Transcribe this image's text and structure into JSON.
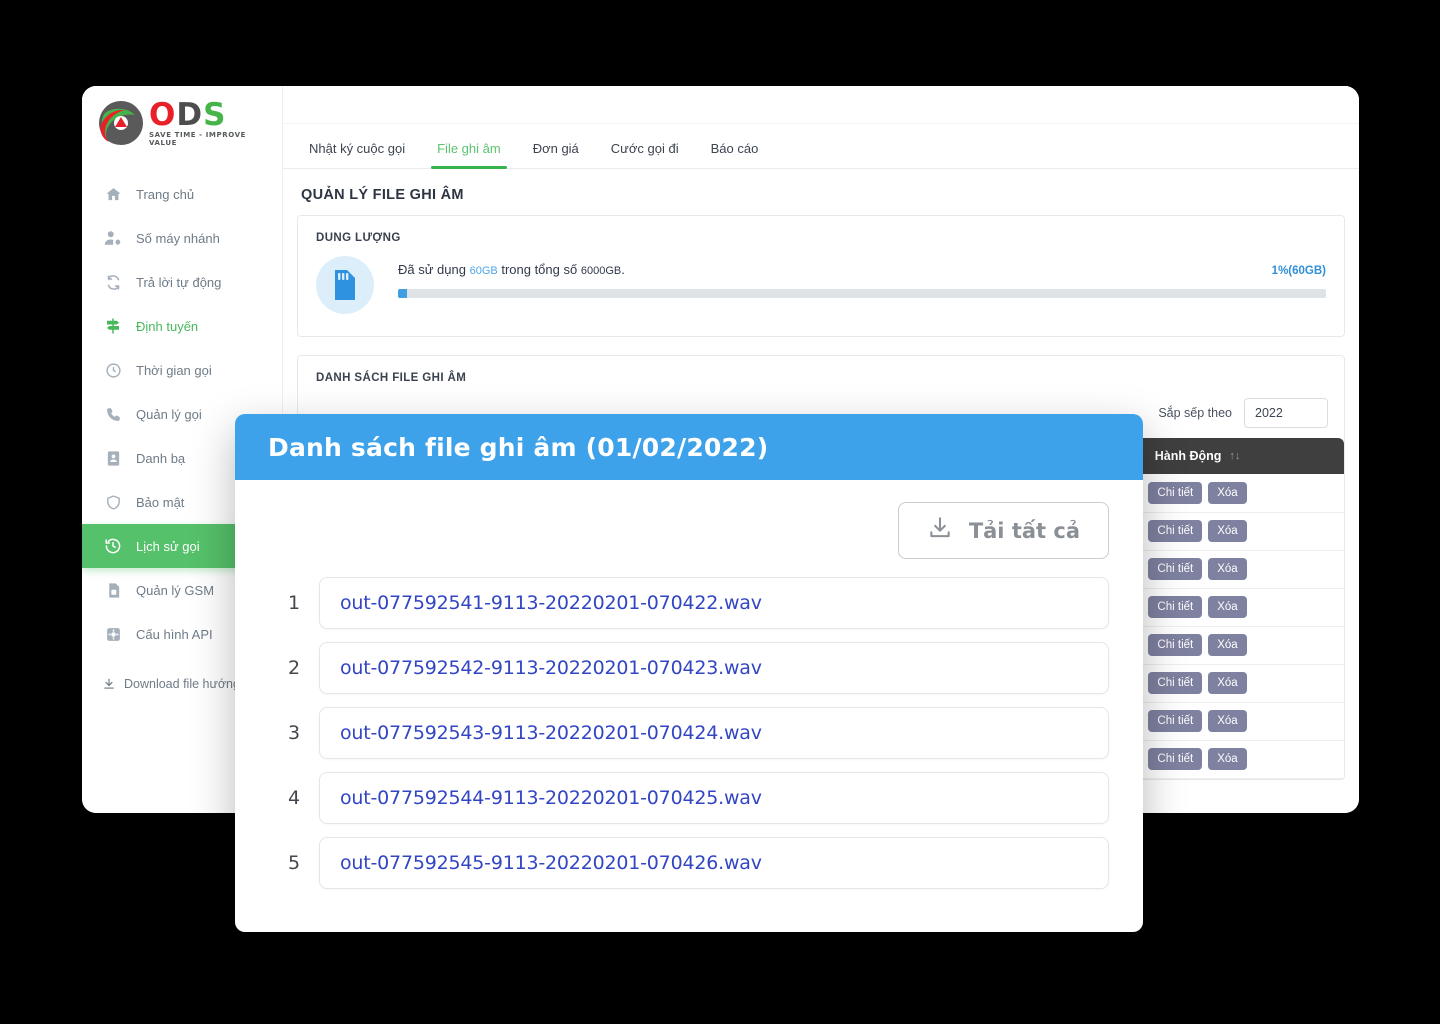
{
  "brand": {
    "logo_o": "O",
    "logo_d": "D",
    "logo_s": "S",
    "tagline": "SAVE TIME - IMPROVE VALUE",
    "logo_icon": "ods-logo-icon"
  },
  "sidebar": {
    "items": [
      {
        "label": "Trang chủ",
        "icon": "home-icon",
        "state": "normal"
      },
      {
        "label": "Số máy nhánh",
        "icon": "user-settings-icon",
        "state": "normal"
      },
      {
        "label": "Trả lời tự động",
        "icon": "refresh-icon",
        "state": "normal"
      },
      {
        "label": "Định tuyến",
        "icon": "signpost-icon",
        "state": "highlight"
      },
      {
        "label": "Thời gian gọi",
        "icon": "clock-icon",
        "state": "normal"
      },
      {
        "label": "Quản lý gọi",
        "icon": "phone-icon",
        "state": "normal"
      },
      {
        "label": "Danh bạ",
        "icon": "contact-book-icon",
        "state": "normal"
      },
      {
        "label": "Bảo mật",
        "icon": "shield-icon",
        "state": "normal"
      },
      {
        "label": "Lịch sử gọi",
        "icon": "history-icon",
        "state": "active"
      },
      {
        "label": "Quản lý GSM",
        "icon": "sim-card-icon",
        "state": "normal"
      },
      {
        "label": "Cấu hình API",
        "icon": "gear-box-icon",
        "state": "normal"
      }
    ],
    "download_link": {
      "label": "Download file hướng dẫn",
      "icon": "download-icon"
    }
  },
  "tabs": [
    {
      "label": "Nhật ký cuộc gọi",
      "active": false
    },
    {
      "label": "File ghi âm",
      "active": true
    },
    {
      "label": "Đơn giá",
      "active": false
    },
    {
      "label": "Cước gọi đi",
      "active": false
    },
    {
      "label": "Báo cáo",
      "active": false
    }
  ],
  "main": {
    "page_title": "QUẢN LÝ FILE GHI ÂM",
    "storage": {
      "section_label": "DUNG LƯỢNG",
      "icon": "sd-card-icon",
      "text_prefix": "Đã sử dụng ",
      "used": "60GB",
      "text_middle": " trong tổng số ",
      "total": "6000GB",
      "text_suffix": ".",
      "percent_label": "1%(60GB)",
      "percent_value": 1,
      "bar_color": "#3f9fe0",
      "track_color": "#dee3e8"
    },
    "list_section": {
      "label": "DANH SÁCH FILE GHI ÂM",
      "sort_label": "Sắp sếp theo",
      "sort_value": "2022",
      "table": {
        "action_header": "Hành Động",
        "sort_icon": "sort-updown-icon",
        "detail_button": "Chi tiết",
        "delete_button": "Xóa",
        "row_count": 8
      }
    }
  },
  "modal": {
    "title": "Danh sách file ghi âm (01/02/2022)",
    "header_color": "#3da2ea",
    "download_all": {
      "label": "Tải tất cả",
      "icon": "download-tray-icon"
    },
    "files": [
      {
        "index": "1",
        "name": "out-077592541-9113-20220201-070422.wav"
      },
      {
        "index": "2",
        "name": "out-077592542-9113-20220201-070423.wav"
      },
      {
        "index": "3",
        "name": "out-077592543-9113-20220201-070424.wav"
      },
      {
        "index": "4",
        "name": "out-077592544-9113-20220201-070425.wav"
      },
      {
        "index": "5",
        "name": "out-077592545-9113-20220201-070426.wav"
      }
    ]
  }
}
